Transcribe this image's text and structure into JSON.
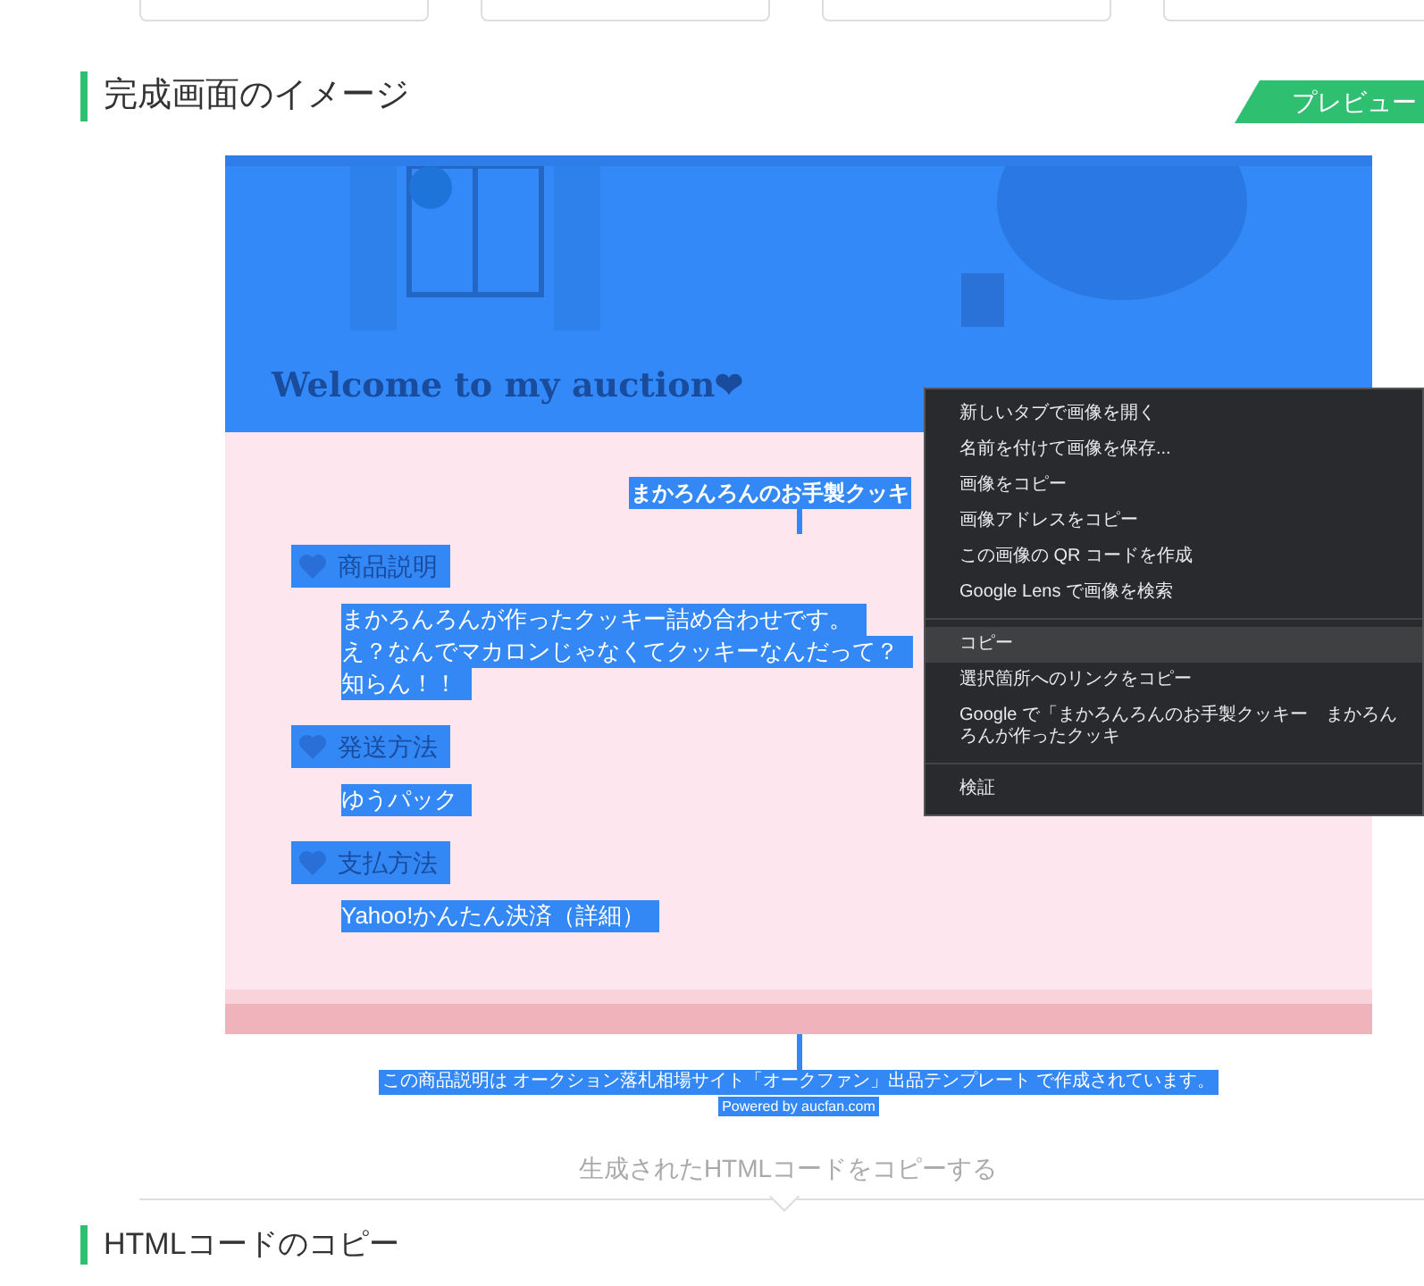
{
  "section_heading": "完成画面のイメージ",
  "preview_tab": {
    "label": "プレビュー",
    "selected": true
  },
  "preview": {
    "banner_title": "Welcome to my auction❤",
    "item_title": "まかろんろんのお手製クッキ",
    "sections": [
      {
        "heading": "商品説明",
        "lines": [
          "まかろんろんが作ったクッキー詰め合わせです。",
          "え？なんでマカロンじゃなくてクッキーなんだって？",
          "知らん！！"
        ]
      },
      {
        "heading": "発送方法",
        "lines": [
          "ゆうパック"
        ]
      },
      {
        "heading": "支払方法",
        "lines": [
          "Yahoo!かんたん決済（詳細）"
        ]
      }
    ],
    "credit": "この商品説明は オークション落札相場サイト「オークファン」出品テンプレート で作成されています。",
    "powered": "Powered by aucfan.com"
  },
  "copy_button": "生成されたHTMLコードをコピーする",
  "next_heading": "HTMLコードのコピー",
  "context_menu": {
    "groups": [
      [
        {
          "label": "新しいタブで画像を開く",
          "selected": false
        },
        {
          "label": "名前を付けて画像を保存...",
          "selected": false
        },
        {
          "label": "画像をコピー",
          "selected": false
        },
        {
          "label": "画像アドレスをコピー",
          "selected": false
        },
        {
          "label": "この画像の QR コードを作成",
          "selected": false
        },
        {
          "label": "Google Lens で画像を検索",
          "selected": false
        }
      ],
      [
        {
          "label": "コピー",
          "selected": true
        },
        {
          "label": "選択箇所へのリンクをコピー",
          "selected": false
        },
        {
          "label": "Google で「まかろんろんのお手製クッキー　まかろんろんが作ったクッキ",
          "selected": false
        }
      ],
      [
        {
          "label": "検証",
          "selected": false
        }
      ]
    ]
  }
}
